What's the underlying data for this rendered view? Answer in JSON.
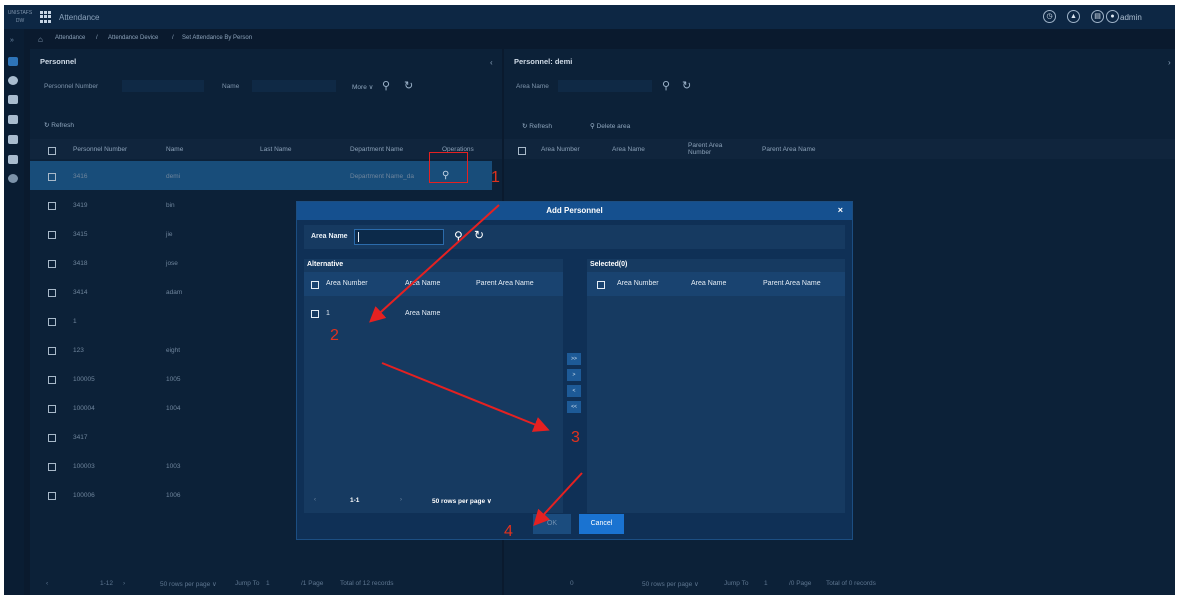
{
  "topbar": {
    "logo_line1": "UNISTAFS",
    "logo_line2": "DW",
    "app_title": "Attendance",
    "user": "admin"
  },
  "breadcrumb": [
    "Attendance",
    "/",
    "Attendance Device",
    "/",
    "Set Attendance By Person"
  ],
  "left": {
    "title": "Personnel",
    "personnel_number_label": "Personnel Number",
    "name_label": "Name",
    "more_label": "More",
    "refresh_label": "Refresh",
    "columns": [
      "Personnel Number",
      "Name",
      "Last Name",
      "Department Name",
      "Operations"
    ],
    "rows": [
      {
        "number": "3416",
        "name": "demi",
        "dept": "Department Name_da"
      },
      {
        "number": "3419",
        "name": "bin",
        "dept": ""
      },
      {
        "number": "3415",
        "name": "jie",
        "dept": ""
      },
      {
        "number": "3418",
        "name": "jose",
        "dept": ""
      },
      {
        "number": "3414",
        "name": "adam",
        "dept": ""
      },
      {
        "number": "1",
        "name": "",
        "dept": ""
      },
      {
        "number": "123",
        "name": "eight",
        "dept": ""
      },
      {
        "number": "100005",
        "name": "1005",
        "dept": ""
      },
      {
        "number": "100004",
        "name": "1004",
        "dept": ""
      },
      {
        "number": "3417",
        "name": "",
        "dept": ""
      },
      {
        "number": "100003",
        "name": "1003",
        "dept": ""
      },
      {
        "number": "100006",
        "name": "1006",
        "dept": ""
      }
    ],
    "pager": {
      "range": "1-12",
      "rows_per_page": "50 rows per page",
      "jump_to": "Jump To",
      "page_input": "1",
      "page_total": "/1 Page",
      "total": "Total of 12 records"
    }
  },
  "right": {
    "title": "Personnel: demi",
    "area_name_label": "Area Name",
    "refresh_label": "Refresh",
    "delete_label": "Delete area",
    "columns": [
      "Area Number",
      "Area Name",
      "Parent Area Number",
      "Parent Area Name"
    ],
    "pager": {
      "range": "0",
      "rows_per_page": "50 rows per page",
      "jump_to": "Jump To",
      "page_input": "1",
      "page_total": "/0 Page",
      "total": "Total of 0 records"
    }
  },
  "modal": {
    "title": "Add Personnel",
    "close": "×",
    "area_name_label": "Area Name",
    "alternative_title": "Alternative",
    "selected_title": "Selected(0)",
    "columns_left": [
      "Area Number",
      "Area Name",
      "Parent Area Name"
    ],
    "columns_right": [
      "Area Number",
      "Area Name",
      "Parent Area Name"
    ],
    "rows": [
      {
        "number": "1",
        "name": "Area Name",
        "parent": ""
      }
    ],
    "transfer": [
      ">>",
      ">",
      "<",
      "<<"
    ],
    "pager": {
      "range": "1-1",
      "rows_per_page": "50 rows per page"
    },
    "ok": "OK",
    "cancel": "Cancel"
  },
  "annotations": [
    "1",
    "2",
    "3",
    "4"
  ],
  "icons": {
    "topbar": [
      "clock-icon",
      "bell-icon",
      "file-icon",
      "user-icon"
    ],
    "sidebar": [
      "device-icon",
      "info-icon",
      "edit-icon",
      "calendar-icon",
      "schedule-icon",
      "report-icon",
      "settings-icon"
    ]
  },
  "colors": {
    "accent": "#1e6fc4",
    "annotation": "#e52121",
    "selected_row": "#184d7a"
  }
}
